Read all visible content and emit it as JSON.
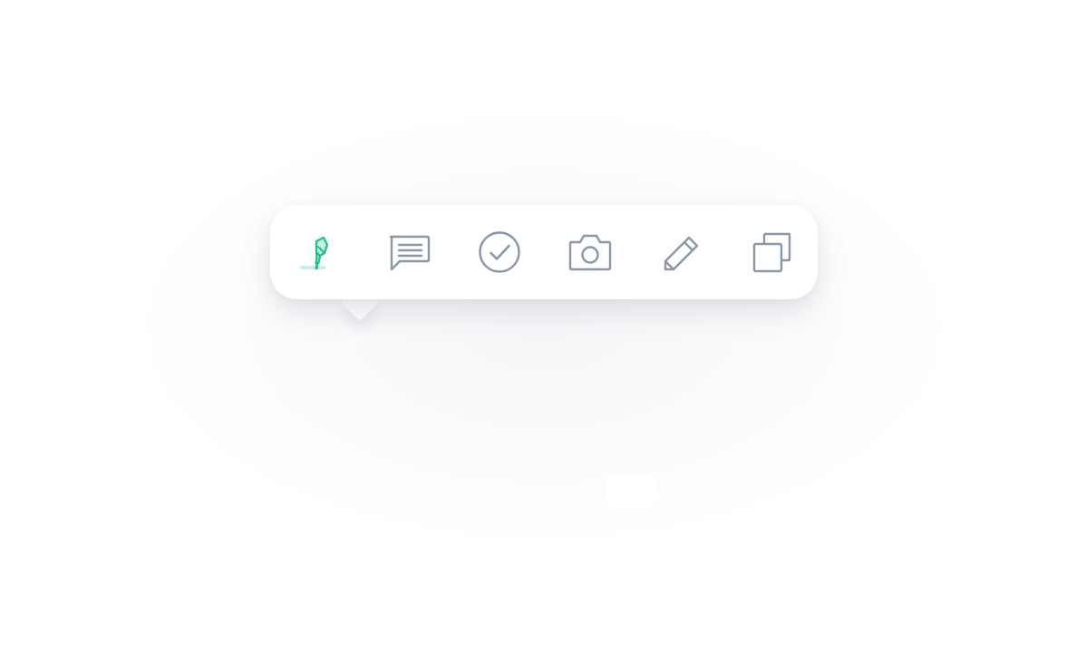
{
  "toolbar": {
    "tools": [
      {
        "id": "highlight",
        "icon": "highlighter-icon",
        "active": true
      },
      {
        "id": "comment",
        "icon": "comment-icon",
        "active": false
      },
      {
        "id": "approve",
        "icon": "check-circle-icon",
        "active": false
      },
      {
        "id": "screenshot",
        "icon": "camera-icon",
        "active": false
      },
      {
        "id": "edit",
        "icon": "pencil-icon",
        "active": false
      },
      {
        "id": "copy",
        "icon": "copy-icon",
        "active": false
      }
    ]
  },
  "colors": {
    "active": "#1fbf86",
    "active_fill": "#c9efe0",
    "icon": "#8a97a6",
    "background": "#ffffff"
  }
}
